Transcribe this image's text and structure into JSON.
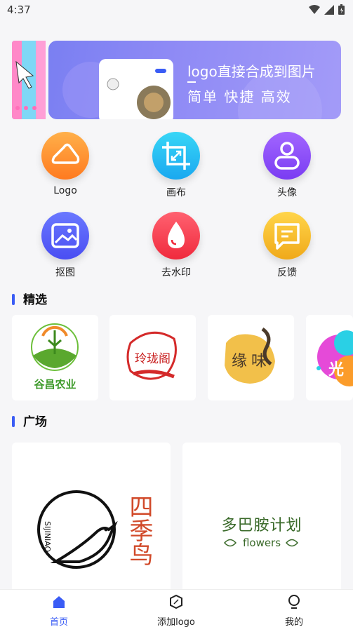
{
  "status_bar": {
    "time": "4:37"
  },
  "banner": {
    "title": "logo直接合成到图片",
    "subtitle": "简单  快捷  高效"
  },
  "categories": [
    {
      "label": "Logo",
      "icon": "cloud-icon",
      "color_top": "#ffb04a",
      "color_bottom": "#ff7a1f"
    },
    {
      "label": "画布",
      "icon": "crop-icon",
      "color_top": "#38d6f6",
      "color_bottom": "#1aa8f0"
    },
    {
      "label": "头像",
      "icon": "user-icon",
      "color_top": "#a266ff",
      "color_bottom": "#7a3cf2"
    },
    {
      "label": "抠图",
      "icon": "image-icon",
      "color_top": "#6a78ff",
      "color_bottom": "#4a4ef2"
    },
    {
      "label": "去水印",
      "icon": "drop-icon",
      "color_top": "#ff6170",
      "color_bottom": "#f02a3d"
    },
    {
      "label": "反馈",
      "icon": "message-icon",
      "color_top": "#ffd54a",
      "color_bottom": "#f0a91a"
    }
  ],
  "featured": {
    "title": "精选",
    "items": [
      {
        "name": "谷昌农业"
      },
      {
        "name": "玲珑阁"
      },
      {
        "name": "缘味"
      },
      {
        "name": "光"
      }
    ]
  },
  "plaza": {
    "title": "广场",
    "items": [
      {
        "name_cn": "四季鸟",
        "name_en": "SIJINIAO"
      },
      {
        "name_cn": "多巴胺计划",
        "name_en": "flowers"
      }
    ]
  },
  "tabbar": {
    "items": [
      {
        "label": "首页",
        "icon": "home-icon",
        "active": true
      },
      {
        "label": "添加logo",
        "icon": "compass-icon",
        "active": false
      },
      {
        "label": "我的",
        "icon": "bulb-icon",
        "active": false
      }
    ]
  },
  "colors": {
    "accent": "#3a5cf5",
    "background": "#f6f6f8"
  }
}
